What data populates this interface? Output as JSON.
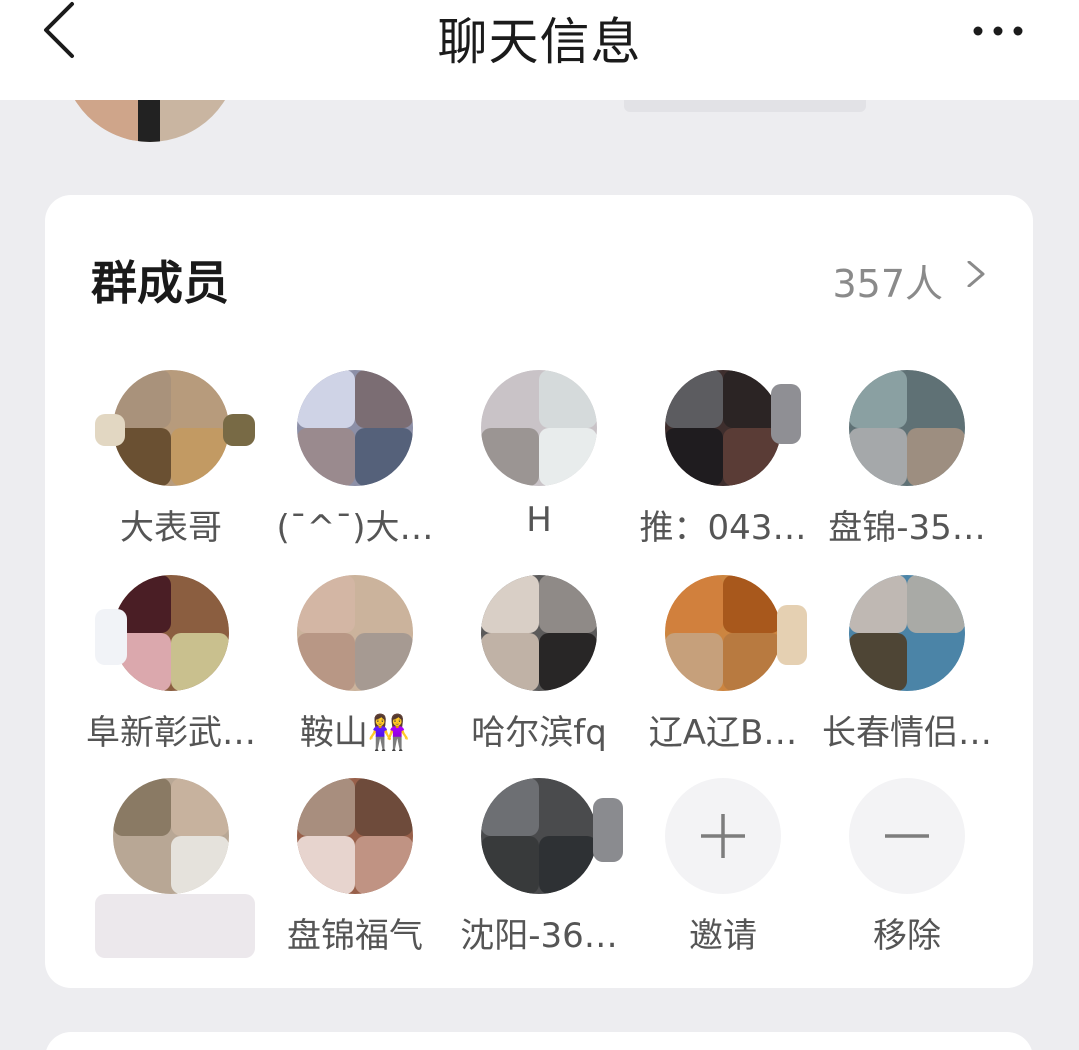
{
  "header": {
    "title": "聊天信息",
    "back_icon": "chevron-left-icon",
    "more_icon": "more-horizontal-icon"
  },
  "members_card": {
    "title": "群成员",
    "count_label": "357人",
    "chevron_icon": "chevron-right-icon",
    "members": [
      {
        "name": "大表哥",
        "colors": [
          "#a9927b",
          "#b79b7c",
          "#6a5032",
          "#c29a63",
          "#786a45",
          "#e2d7c2"
        ]
      },
      {
        "name": "(ˉ^ˉ)大…",
        "colors": [
          "#cfd3e6",
          "#8c8fa7",
          "#7b6d73",
          "#9a8a8e",
          "#55617a",
          "#dcdde6"
        ]
      },
      {
        "name": "H",
        "colors": [
          "#c9c3c7",
          "#a9b4b8",
          "#d5dadb",
          "#9b9593",
          "#b1b2b2",
          "#e8ecec"
        ]
      },
      {
        "name": "推：043…",
        "colors": [
          "#5c5c60",
          "#2b2424",
          "#3e2e2d",
          "#5a3c36",
          "#8f8f94",
          "#1f1c1f"
        ]
      },
      {
        "name": "盘锦-35…",
        "colors": [
          "#8aa0a2",
          "#5f7175",
          "#9d8e80",
          "#6f6a6b",
          "#a5a8aa",
          "#d4dad9"
        ]
      },
      {
        "name": "阜新彰武…",
        "colors": [
          "#4a1e25",
          "#8b5e40",
          "#9a8a83",
          "#dba8ad",
          "#c9c08e",
          "#f1f3f7"
        ]
      },
      {
        "name": "鞍山👭",
        "colors": [
          "#d3b6a4",
          "#b89785",
          "#cbb39c",
          "#a69a92",
          "#b9a79b",
          "#e8dcd3"
        ]
      },
      {
        "name": "哈尔滨fq",
        "colors": [
          "#d9cfc6",
          "#c0b2a6",
          "#8f8a87",
          "#282626",
          "#5b5a5a",
          "#e4e6ea"
        ]
      },
      {
        "name": "辽A辽B…",
        "colors": [
          "#d1803d",
          "#cc8540",
          "#a8581c",
          "#c6a07b",
          "#e5d0b2",
          "#b87a40"
        ]
      },
      {
        "name": "长春情侣…",
        "colors": [
          "#bfb8b3",
          "#4e4535",
          "#a9aaa6",
          "#4b84a7",
          "#5d6875",
          "#d6d2cb"
        ]
      },
      {
        "name": "",
        "colors": [
          "#c7b29e",
          "#b8a795",
          "#8a7a64",
          "#e5e2dc",
          "#e8e0dd",
          "#d9d9e0"
        ]
      },
      {
        "name": "盘锦福气",
        "colors": [
          "#a88e7e",
          "#98604a",
          "#6e4b3b",
          "#5c4a4a",
          "#e7d4ce",
          "#c09383"
        ]
      },
      {
        "name": "沈阳-36…",
        "colors": [
          "#6d6f73",
          "#4a4b4d",
          "#383a3b",
          "#2e3134",
          "#8a8b8f",
          "#555759"
        ]
      }
    ],
    "actions": [
      {
        "label": "邀请",
        "icon": "plus-icon"
      },
      {
        "label": "移除",
        "icon": "minus-icon"
      }
    ]
  }
}
